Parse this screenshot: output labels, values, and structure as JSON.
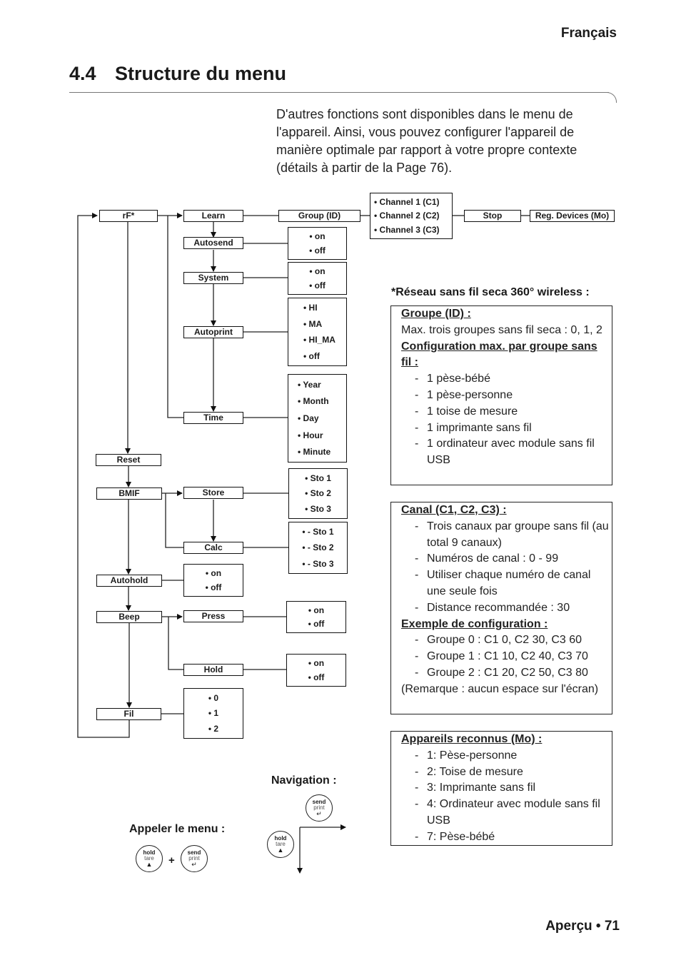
{
  "header": {
    "language": "Français",
    "section_number": "4.4",
    "section_title": "Structure du menu"
  },
  "intro_text": "D'autres fonctions sont disponibles dans le menu de l'appareil. Ainsi, vous pouvez configurer l'appareil de manière optimale par rapport à votre propre contexte (détails à partir de la Page 76).",
  "menu": {
    "rf": "rF*",
    "learn": "Learn",
    "group_id": "Group (ID)",
    "channels": [
      "• Channel 1 (C1)",
      "• Channel 2 (C2)",
      "• Channel 3 (C3)"
    ],
    "stop": "Stop",
    "reg_devices": "Reg. Devices (Mo)",
    "autosend": "Autosend",
    "autosend_opts": [
      "• on",
      "• off"
    ],
    "system": "System",
    "system_opts": [
      "• on",
      "• off"
    ],
    "autoprint": "Autoprint",
    "autoprint_opts": [
      "• HI",
      "• MA",
      "• HI_MA",
      "• off"
    ],
    "time": "Time",
    "time_opts": [
      "• Year",
      "• Month",
      "• Day",
      "• Hour",
      "• Minute"
    ],
    "reset": "Reset",
    "bmif": "BMIF",
    "store": "Store",
    "store_opts": [
      "• Sto 1",
      "• Sto 2",
      "• Sto 3"
    ],
    "calc": "Calc",
    "calc_opts": [
      "• - Sto 1",
      "• - Sto 2",
      "• - Sto 3"
    ],
    "autohold": "Autohold",
    "autohold_opts": [
      "• on",
      "• off"
    ],
    "beep": "Beep",
    "press": "Press",
    "press_opts": [
      "• on",
      "• off"
    ],
    "hold": "Hold",
    "hold_opts": [
      "• on",
      "• off"
    ],
    "fil": "Fil",
    "fil_opts": [
      "• 0",
      "• 1",
      "• 2"
    ]
  },
  "wireless": {
    "heading": "*Réseau sans fil seca 360° wireless :",
    "box1": {
      "h1": "Groupe (ID) :",
      "p1": "Max. trois groupes sans fil seca : 0, 1, 2",
      "h2": "Configuration max. par groupe sans fil :",
      "items": [
        "1 pèse-bébé",
        "1 pèse-personne",
        "1 toise de mesure",
        "1 imprimante sans fil",
        "1 ordinateur avec module sans fil USB"
      ]
    },
    "box2": {
      "h1": "Canal (C1, C2, C3) :",
      "items": [
        "Trois canaux par groupe sans fil (au total 9 canaux)",
        "Numéros de canal : 0 - 99",
        "Utiliser chaque numéro de canal une seule fois",
        "Distance recommandée : 30"
      ],
      "h2": "Exemple de configuration :",
      "examples": [
        "Groupe 0 : C1 0, C2 30, C3 60",
        "Groupe 1 : C1 10, C2 40, C3 70",
        "Groupe 2 : C1 20, C2 50, C3 80"
      ],
      "note": "(Remarque : aucun espace sur l'écran)"
    },
    "box3": {
      "h1": "Appareils reconnus (Mo) :",
      "items": [
        "1: Pèse-personne",
        "2: Toise de mesure",
        "3: Imprimante sans fil",
        "4: Ordinateur avec module sans fil USB",
        "7: Pèse-bébé"
      ]
    }
  },
  "controls": {
    "navigation_label": "Navigation :",
    "call_menu_label": "Appeler le menu :",
    "plus": "+",
    "hold_button": {
      "line1": "hold",
      "line2": "tare",
      "symbol": "▲"
    },
    "send_button": {
      "line1": "send",
      "line2": "print",
      "symbol": "↵"
    }
  },
  "footer": {
    "page_label": "Aperçu • 71"
  }
}
